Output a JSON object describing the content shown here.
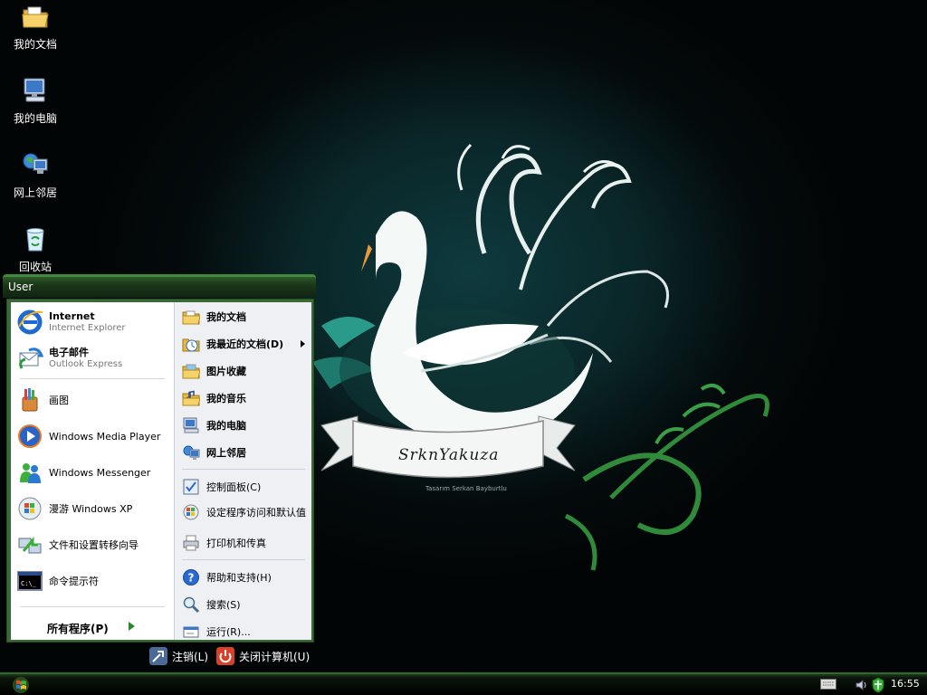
{
  "desktop_icons": [
    {
      "label": "我的文档",
      "icon": "folder-documents-icon"
    },
    {
      "label": "我的电脑",
      "icon": "computer-icon"
    },
    {
      "label": "网上邻居",
      "icon": "network-icon"
    },
    {
      "label": "回收站",
      "icon": "recycle-bin-icon"
    }
  ],
  "wallpaper": {
    "banner_text": "SrknYakuza",
    "credit": "Tasarım Serkan Bayburtlu"
  },
  "start_menu": {
    "user": "User",
    "pinned": [
      {
        "title": "Internet",
        "subtitle": "Internet Explorer"
      },
      {
        "title": "电子邮件",
        "subtitle": "Outlook Express"
      }
    ],
    "recent": [
      "画图",
      "Windows Media Player",
      "Windows Messenger",
      "漫游 Windows XP",
      "文件和设置转移向导",
      "命令提示符"
    ],
    "all_programs": "所有程序(P)",
    "places": [
      {
        "label": "我的文档"
      },
      {
        "label": "我最近的文档(D)"
      },
      {
        "label": "图片收藏"
      },
      {
        "label": "我的音乐"
      },
      {
        "label": "我的电脑"
      },
      {
        "label": "网上邻居"
      }
    ],
    "settings": [
      {
        "label": "控制面板(C)"
      },
      {
        "label": "设定程序访问和默认值"
      },
      {
        "label": "打印机和传真"
      }
    ],
    "help": [
      {
        "label": "帮助和支持(H)"
      },
      {
        "label": "搜索(S)"
      },
      {
        "label": "运行(R)..."
      }
    ],
    "logoff": "注销(L)",
    "shutdown": "关闭计算机(U)"
  },
  "taskbar": {
    "clock": "16:55"
  }
}
